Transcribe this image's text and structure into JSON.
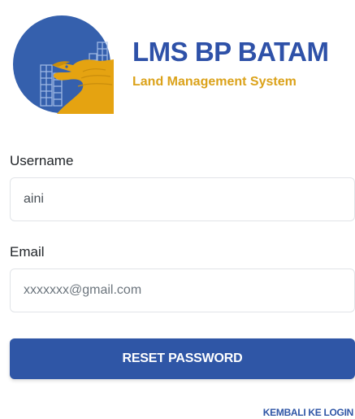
{
  "brand": {
    "title": "LMS BP BATAM",
    "subtitle": "Land Management System",
    "logo_icon": "bp-batam-eagle-emblem"
  },
  "form": {
    "username_label": "Username",
    "username_value": "aini",
    "email_label": "Email",
    "email_placeholder": "xxxxxxx@gmail.com",
    "email_value": "",
    "submit_label": "RESET PASSWORD"
  },
  "links": {
    "back_to_login": "KEMBALI KE LOGIN"
  },
  "colors": {
    "brand_blue": "#2e51a8",
    "brand_gold": "#dba21a",
    "button_blue": "#2f56a6",
    "emblem_blue": "#3560ad",
    "emblem_gold": "#e5a311"
  }
}
